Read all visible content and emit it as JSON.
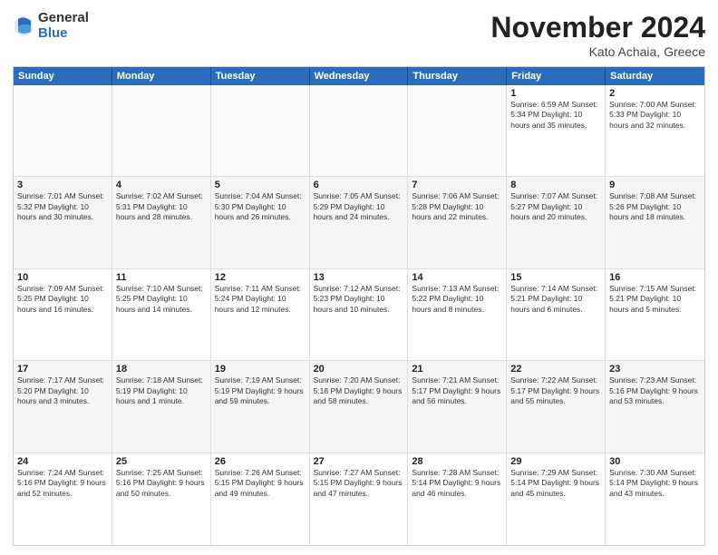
{
  "logo": {
    "general": "General",
    "blue": "Blue"
  },
  "title": "November 2024",
  "location": "Kato Achaia, Greece",
  "header": {
    "days": [
      "Sunday",
      "Monday",
      "Tuesday",
      "Wednesday",
      "Thursday",
      "Friday",
      "Saturday"
    ]
  },
  "weeks": [
    [
      {
        "day": "",
        "content": ""
      },
      {
        "day": "",
        "content": ""
      },
      {
        "day": "",
        "content": ""
      },
      {
        "day": "",
        "content": ""
      },
      {
        "day": "",
        "content": ""
      },
      {
        "day": "1",
        "content": "Sunrise: 6:59 AM\nSunset: 5:34 PM\nDaylight: 10 hours\nand 35 minutes."
      },
      {
        "day": "2",
        "content": "Sunrise: 7:00 AM\nSunset: 5:33 PM\nDaylight: 10 hours\nand 32 minutes."
      }
    ],
    [
      {
        "day": "3",
        "content": "Sunrise: 7:01 AM\nSunset: 5:32 PM\nDaylight: 10 hours\nand 30 minutes."
      },
      {
        "day": "4",
        "content": "Sunrise: 7:02 AM\nSunset: 5:31 PM\nDaylight: 10 hours\nand 28 minutes."
      },
      {
        "day": "5",
        "content": "Sunrise: 7:04 AM\nSunset: 5:30 PM\nDaylight: 10 hours\nand 26 minutes."
      },
      {
        "day": "6",
        "content": "Sunrise: 7:05 AM\nSunset: 5:29 PM\nDaylight: 10 hours\nand 24 minutes."
      },
      {
        "day": "7",
        "content": "Sunrise: 7:06 AM\nSunset: 5:28 PM\nDaylight: 10 hours\nand 22 minutes."
      },
      {
        "day": "8",
        "content": "Sunrise: 7:07 AM\nSunset: 5:27 PM\nDaylight: 10 hours\nand 20 minutes."
      },
      {
        "day": "9",
        "content": "Sunrise: 7:08 AM\nSunset: 5:26 PM\nDaylight: 10 hours\nand 18 minutes."
      }
    ],
    [
      {
        "day": "10",
        "content": "Sunrise: 7:09 AM\nSunset: 5:25 PM\nDaylight: 10 hours\nand 16 minutes."
      },
      {
        "day": "11",
        "content": "Sunrise: 7:10 AM\nSunset: 5:25 PM\nDaylight: 10 hours\nand 14 minutes."
      },
      {
        "day": "12",
        "content": "Sunrise: 7:11 AM\nSunset: 5:24 PM\nDaylight: 10 hours\nand 12 minutes."
      },
      {
        "day": "13",
        "content": "Sunrise: 7:12 AM\nSunset: 5:23 PM\nDaylight: 10 hours\nand 10 minutes."
      },
      {
        "day": "14",
        "content": "Sunrise: 7:13 AM\nSunset: 5:22 PM\nDaylight: 10 hours\nand 8 minutes."
      },
      {
        "day": "15",
        "content": "Sunrise: 7:14 AM\nSunset: 5:21 PM\nDaylight: 10 hours\nand 6 minutes."
      },
      {
        "day": "16",
        "content": "Sunrise: 7:15 AM\nSunset: 5:21 PM\nDaylight: 10 hours\nand 5 minutes."
      }
    ],
    [
      {
        "day": "17",
        "content": "Sunrise: 7:17 AM\nSunset: 5:20 PM\nDaylight: 10 hours\nand 3 minutes."
      },
      {
        "day": "18",
        "content": "Sunrise: 7:18 AM\nSunset: 5:19 PM\nDaylight: 10 hours\nand 1 minute."
      },
      {
        "day": "19",
        "content": "Sunrise: 7:19 AM\nSunset: 5:19 PM\nDaylight: 9 hours\nand 59 minutes."
      },
      {
        "day": "20",
        "content": "Sunrise: 7:20 AM\nSunset: 5:18 PM\nDaylight: 9 hours\nand 58 minutes."
      },
      {
        "day": "21",
        "content": "Sunrise: 7:21 AM\nSunset: 5:17 PM\nDaylight: 9 hours\nand 56 minutes."
      },
      {
        "day": "22",
        "content": "Sunrise: 7:22 AM\nSunset: 5:17 PM\nDaylight: 9 hours\nand 55 minutes."
      },
      {
        "day": "23",
        "content": "Sunrise: 7:23 AM\nSunset: 5:16 PM\nDaylight: 9 hours\nand 53 minutes."
      }
    ],
    [
      {
        "day": "24",
        "content": "Sunrise: 7:24 AM\nSunset: 5:16 PM\nDaylight: 9 hours\nand 52 minutes."
      },
      {
        "day": "25",
        "content": "Sunrise: 7:25 AM\nSunset: 5:16 PM\nDaylight: 9 hours\nand 50 minutes."
      },
      {
        "day": "26",
        "content": "Sunrise: 7:26 AM\nSunset: 5:15 PM\nDaylight: 9 hours\nand 49 minutes."
      },
      {
        "day": "27",
        "content": "Sunrise: 7:27 AM\nSunset: 5:15 PM\nDaylight: 9 hours\nand 47 minutes."
      },
      {
        "day": "28",
        "content": "Sunrise: 7:28 AM\nSunset: 5:14 PM\nDaylight: 9 hours\nand 46 minutes."
      },
      {
        "day": "29",
        "content": "Sunrise: 7:29 AM\nSunset: 5:14 PM\nDaylight: 9 hours\nand 45 minutes."
      },
      {
        "day": "30",
        "content": "Sunrise: 7:30 AM\nSunset: 5:14 PM\nDaylight: 9 hours\nand 43 minutes."
      }
    ]
  ]
}
